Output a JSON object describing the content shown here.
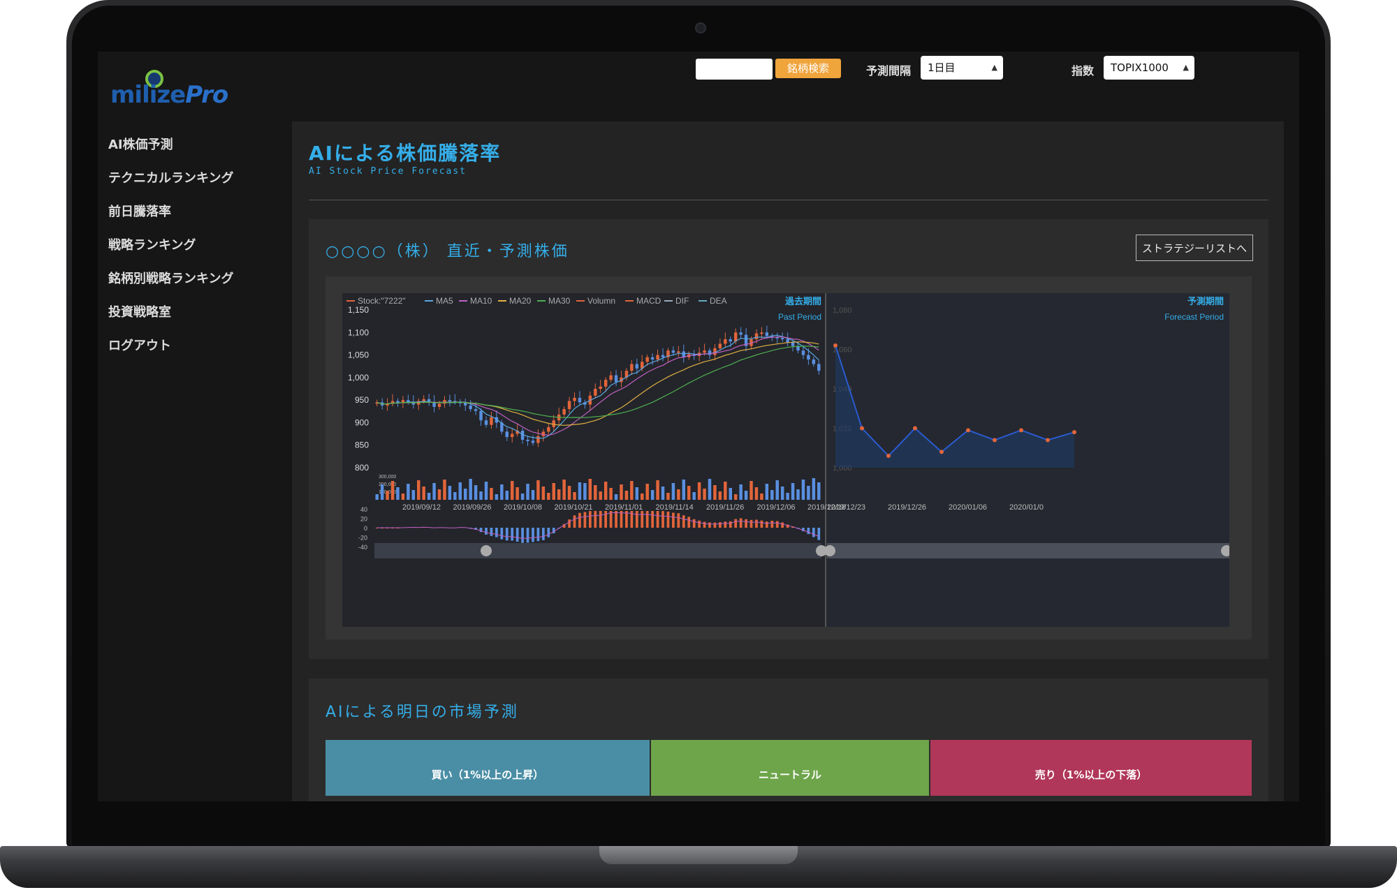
{
  "header": {
    "search_button": "銘柄検索",
    "period_label": "予測間隔",
    "period_value": "1日目",
    "index_label": "指数",
    "index_value": "TOPIX1000"
  },
  "logo": {
    "text_a": "milize",
    "text_b": "Pro"
  },
  "sidebar": {
    "items": [
      {
        "label": "AI株価予測"
      },
      {
        "label": "テクニカルランキング"
      },
      {
        "label": "前日騰落率"
      },
      {
        "label": "戦略ランキング"
      },
      {
        "label": "銘柄別戦略ランキング"
      },
      {
        "label": "投資戦略室"
      },
      {
        "label": "ログアウト"
      }
    ]
  },
  "page": {
    "title": "AIによる株価騰落率",
    "subtitle": "AI Stock Price Forecast"
  },
  "stock_panel": {
    "title": "○○○○（株） 直近・予測株価",
    "strategy_button": "ストラテジーリストへ"
  },
  "market_panel": {
    "title": "AIによる明日の市場予測",
    "buy": "買い（1%以上の上昇）",
    "neutral": "ニュートラル",
    "sell": "売り（1%以上の下落）"
  },
  "colors": {
    "accent": "#35aee9",
    "up": "#e2653b",
    "down": "#5a8fe0",
    "buy": "#4a8ea5",
    "neutral": "#6ea54a",
    "sell": "#b0375a"
  },
  "chart_data": [
    {
      "type": "candlestick",
      "legend": [
        "Stock:\"7222\"",
        "MA5",
        "MA10",
        "MA20",
        "MA30",
        "Volumn",
        "MACD",
        "DIF",
        "DEA"
      ],
      "past_label": "過去期間",
      "past_label_en": "Past Period",
      "ylim": [
        800,
        1150
      ],
      "y_ticks": [
        "1,150",
        "1,100",
        "1,050",
        "1,000",
        "950",
        "900",
        "850",
        "800"
      ],
      "x_ticks": [
        "2019/09/12",
        "2019/09/26",
        "2019/10/08",
        "2019/10/21",
        "2019/11/01",
        "2019/11/14",
        "2019/11/26",
        "2019/12/06",
        "2019/12/18"
      ],
      "close": [
        945,
        938,
        942,
        948,
        944,
        950,
        946,
        940,
        948,
        952,
        946,
        935,
        942,
        950,
        948,
        946,
        944,
        938,
        930,
        926,
        905,
        895,
        912,
        900,
        880,
        868,
        875,
        882,
        862,
        860,
        855,
        870,
        880,
        890,
        905,
        918,
        930,
        948,
        955,
        945,
        940,
        960,
        975,
        980,
        995,
        1005,
        990,
        1000,
        1015,
        1030,
        1020,
        1035,
        1045,
        1040,
        1050,
        1045,
        1060,
        1055,
        1058,
        1045,
        1052,
        1048,
        1055,
        1060,
        1050,
        1065,
        1075,
        1085,
        1080,
        1100,
        1095,
        1070,
        1085,
        1098,
        1100,
        1092,
        1090,
        1088,
        1085,
        1078,
        1070,
        1060,
        1050,
        1040,
        1030,
        1015
      ],
      "volume_ticks": [
        "300,000",
        "200,000",
        "100,000"
      ],
      "macd_ticks": [
        "40",
        "20",
        "0",
        "-20",
        "-40"
      ]
    },
    {
      "type": "line",
      "forecast_label": "予測期間",
      "forecast_label_en": "Forecast Period",
      "y_ticks": [
        "1,080",
        "1,060",
        "1,040",
        "1,020",
        "1,000"
      ],
      "x_ticks": [
        "2019/12/23",
        "2019/12/26",
        "2020/01/06",
        "2020/01/0"
      ],
      "values": [
        1062,
        1020,
        1006,
        1020,
        1008,
        1019,
        1014,
        1019,
        1014,
        1018
      ]
    }
  ]
}
